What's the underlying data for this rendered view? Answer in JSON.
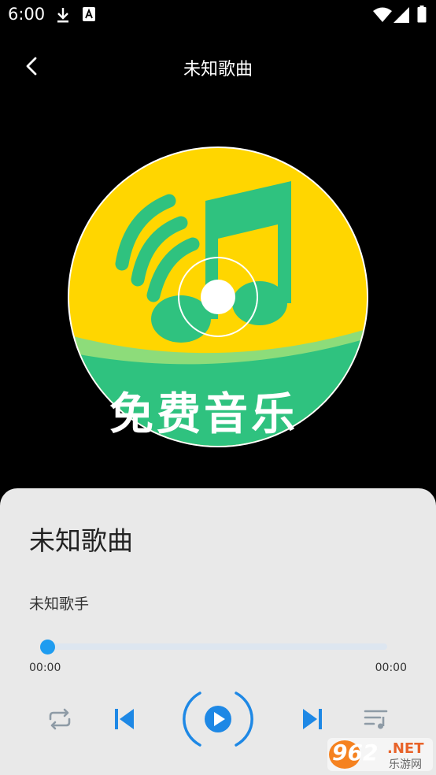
{
  "status_bar": {
    "time": "6:00",
    "icons": [
      "download-icon",
      "font-icon",
      "wifi-icon",
      "signal-icon",
      "battery-icon"
    ]
  },
  "header": {
    "title": "未知歌曲",
    "back_icon": "chevron-left-icon"
  },
  "disc": {
    "label_text": "免费音乐",
    "colors": {
      "yellow": "#ffd600",
      "green": "#2fc27f"
    }
  },
  "player": {
    "song_title": "未知歌曲",
    "artist": "未知歌手",
    "current_time": "00:00",
    "total_time": "00:00",
    "progress": 0,
    "controls": [
      "repeat-icon",
      "previous-icon",
      "play-icon",
      "next-icon",
      "playlist-icon"
    ],
    "accent_color": "#2196f3"
  },
  "watermark": {
    "brand": "962",
    "suffix": ".NET",
    "site": "乐游网"
  }
}
